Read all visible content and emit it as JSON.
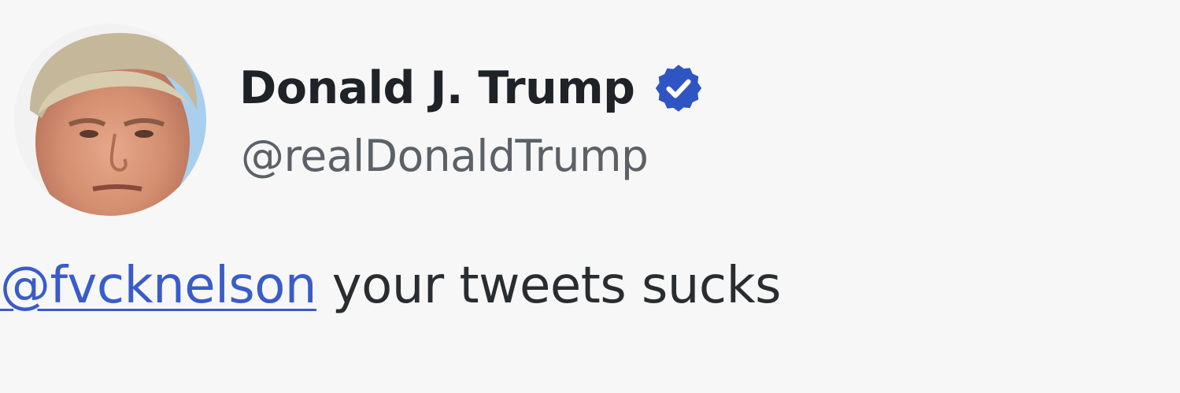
{
  "tweet": {
    "display_name": "Donald J. Trump",
    "handle": "@realDonaldTrump",
    "verified_icon": "verified-badge-icon",
    "mention": "@fvcknelson",
    "body_text": " your tweets sucks"
  },
  "colors": {
    "background": "#f7f7f7",
    "name": "#1f2328",
    "handle": "#5b6167",
    "mention": "#3a5cc9",
    "verified": "#2f55c4"
  }
}
